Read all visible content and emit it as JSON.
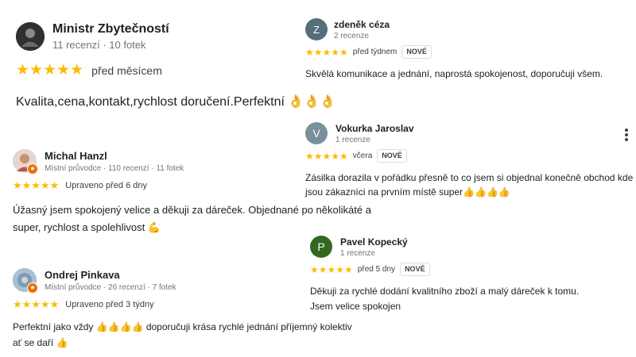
{
  "colors": {
    "star": "#fbbc04",
    "avatar_z": "#546e7a",
    "avatar_v": "#78909c",
    "avatar_p": "#33691e",
    "local_guide": "#e8710a"
  },
  "reviews": [
    {
      "name": "Ministr Zbytečností",
      "stats": "11 recenzí · 10 fotek",
      "stars": "★★★★★",
      "rating": 5,
      "when": "před měsícem",
      "text": "Kvalita,cena,kontakt,rychlost doručení.Perfektní 👌👌👌"
    },
    {
      "name": "zdeněk céza",
      "initial": "Z",
      "stats": "2 recenze",
      "stars": "★★★★★",
      "rating": 5,
      "when": "před týdnem",
      "badge": "NOVÉ",
      "text": "Skvělá komunikace a jednání, naprostá spokojenost, doporučuji všem."
    },
    {
      "name": "Vokurka Jaroslav",
      "initial": "V",
      "stats": "1 recenze",
      "stars": "★★★★★",
      "rating": 5,
      "when": "včera",
      "badge": "NOVÉ",
      "text1": "Zásilka dorazila v pořádku přesně to co jsem si objednal konečně obchod kde",
      "text2": "jsou zákazníci na prvním místě super👍👍👍👍"
    },
    {
      "name": "Michal Hanzl",
      "stats": "Místní průvodce · 110 recenzí · 11 fotek",
      "stars": "★★★★★",
      "rating": 5,
      "when": "Upraveno před 6 dny",
      "text1": "Úžasný jsem spokojený velice a děkuji za dáreček. Objednané po několikáté a",
      "text2": "super, rychlost a spolehlivost 💪"
    },
    {
      "name": "Pavel Kopecký",
      "initial": "P",
      "stats": "1 recenze",
      "stars": "★★★★★",
      "rating": 5,
      "when": "před 5 dny",
      "badge": "NOVÉ",
      "text1": "Děkuji za rychlé dodání kvalitního zboží a malý dáreček k tomu.",
      "text2": "Jsem velice spokojen"
    },
    {
      "name": "Ondrej Pinkava",
      "stats": "Místní průvodce · 26 recenzí · 7 fotek",
      "stars": "★★★★★",
      "rating": 5,
      "when": "Upraveno před 3 týdny",
      "text1": "Perfektní jako vždy 👍👍👍👍 doporučuji krása rychlé jednání příjemný kolektiv",
      "text2": "ať se daří 👍"
    }
  ]
}
